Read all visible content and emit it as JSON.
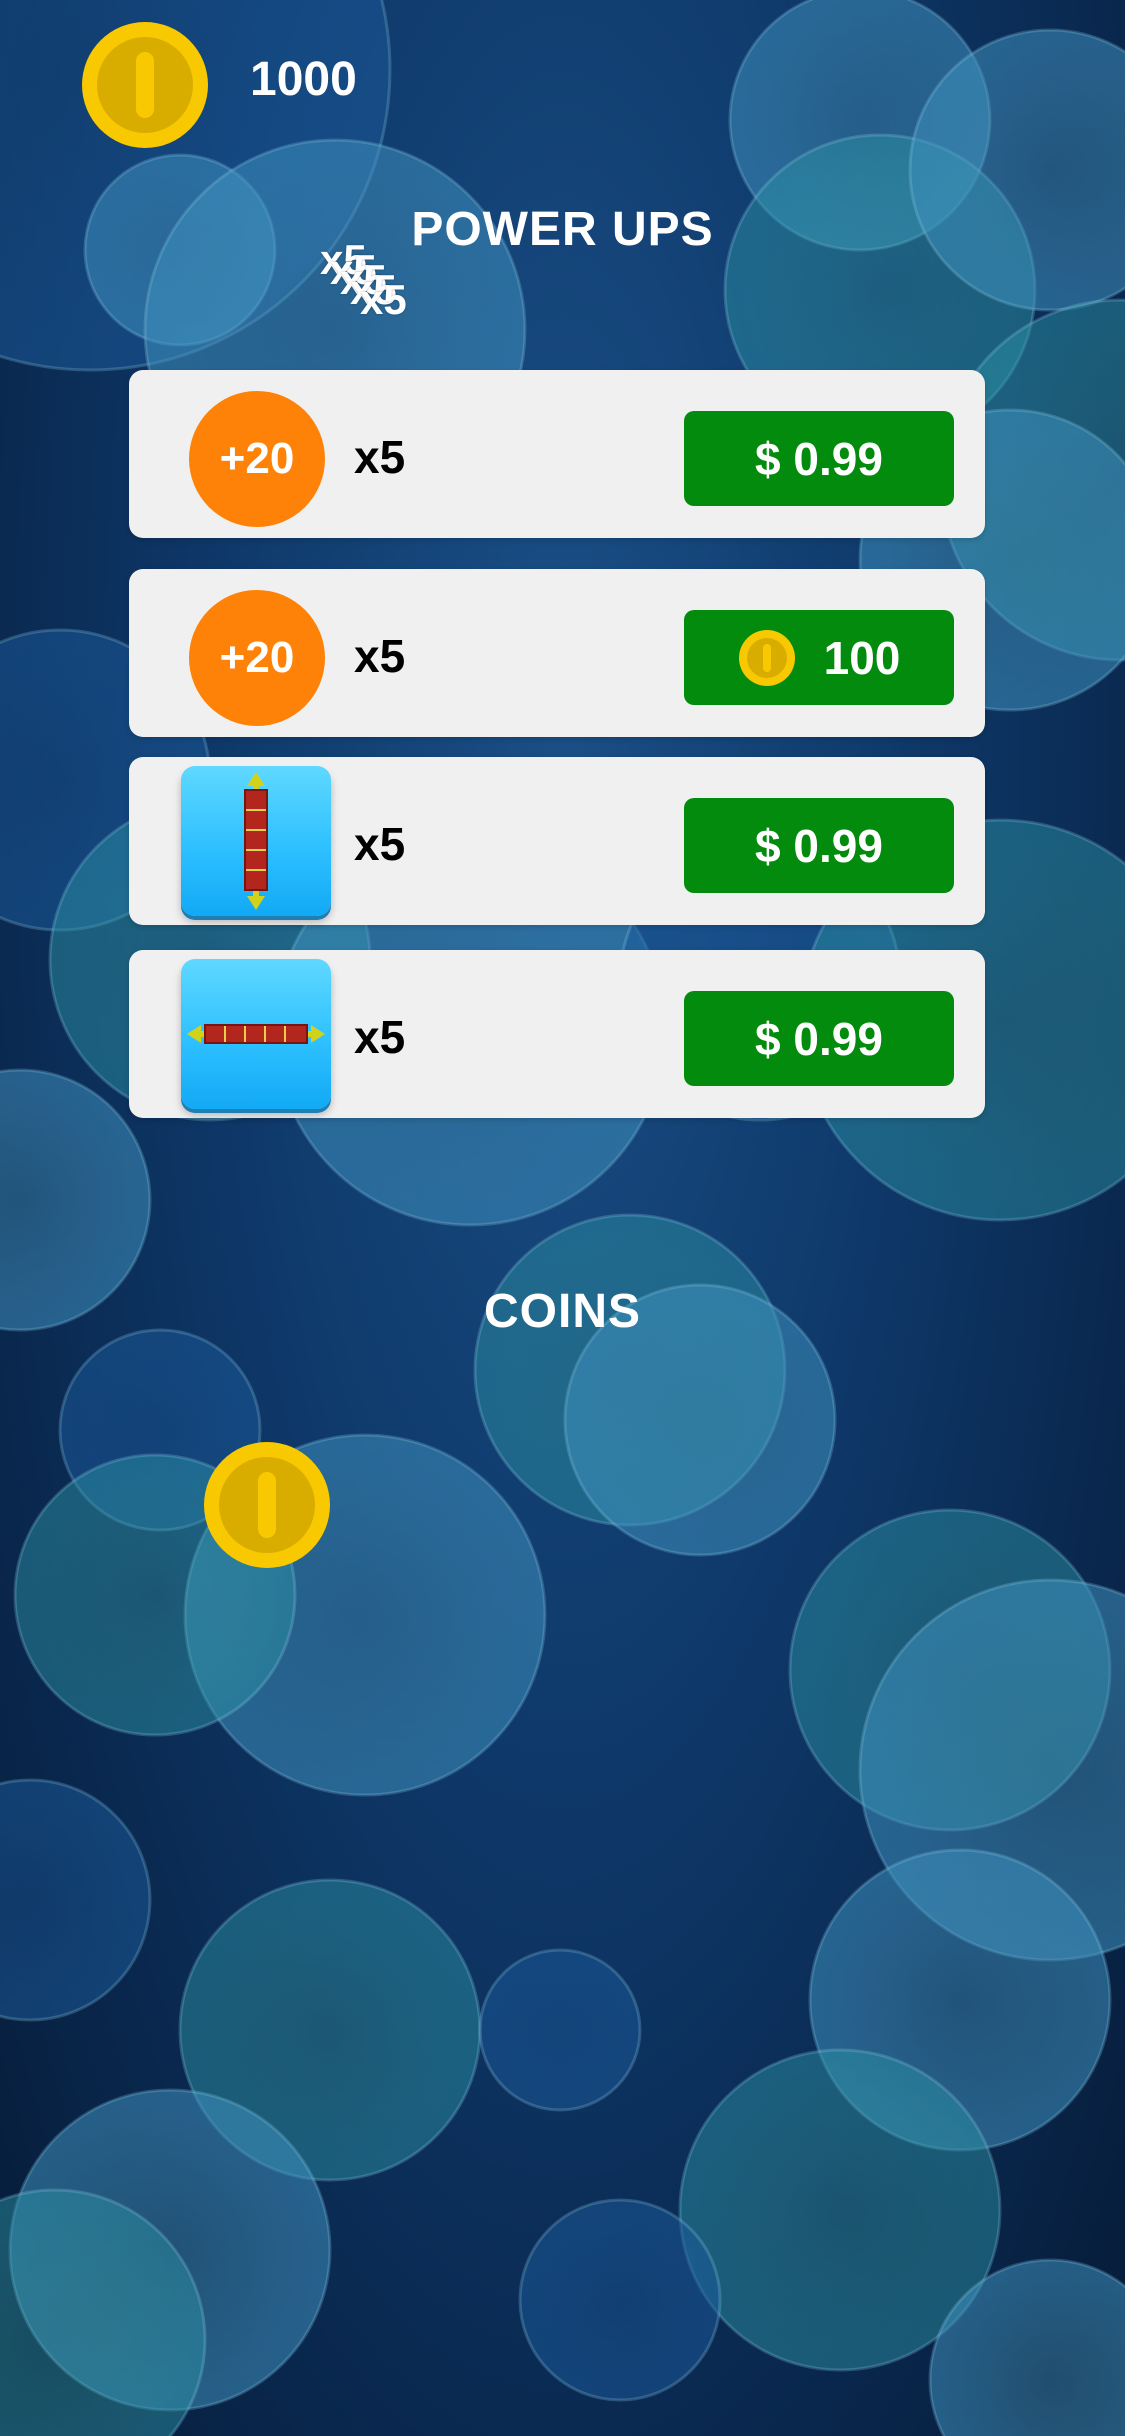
{
  "header": {
    "balance": "1000",
    "coin_icon": "gold-coin-icon"
  },
  "powerups": {
    "title": "POWER UPS",
    "overlay_glyphs": [
      "x5",
      "x5",
      "x5",
      "x5",
      "x5"
    ],
    "items": [
      {
        "icon": "plus20-badge-icon",
        "badge": "+20",
        "quantity": "x5",
        "price": "$ 0.99",
        "currency": "usd"
      },
      {
        "icon": "plus20-badge-icon",
        "badge": "+20",
        "quantity": "x5",
        "price": "100",
        "currency": "coins"
      },
      {
        "icon": "vertical-bomb-icon",
        "quantity": "x5",
        "price": "$ 0.99",
        "currency": "usd"
      },
      {
        "icon": "horizontal-bomb-icon",
        "quantity": "x5",
        "price": "$ 0.99",
        "currency": "usd"
      }
    ]
  },
  "coins": {
    "title": "COINS",
    "pack_icon": "gold-coin-icon"
  },
  "colors": {
    "buy_button": "#038b0d",
    "badge_orange": "#ff8208",
    "tile_blue": "#2ec0ff",
    "coin_gold": "#f7c800",
    "row_bg": "#f0f0f0"
  }
}
